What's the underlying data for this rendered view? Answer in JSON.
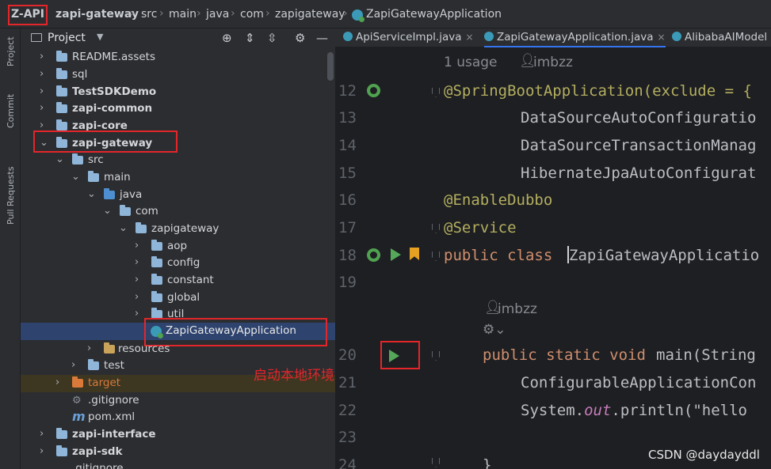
{
  "breadcrumb": {
    "app": "Z-API",
    "items": [
      "zapi-gateway",
      "src",
      "main",
      "java",
      "com",
      "zapigateway",
      "ZapiGatewayApplication"
    ]
  },
  "activity_bar": {
    "tabs": [
      "Project",
      "Commit",
      "Pull Requests"
    ]
  },
  "project_panel": {
    "title": "Project",
    "tree": [
      {
        "label": "README.assets"
      },
      {
        "label": "sql"
      },
      {
        "label": "TestSDKDemo"
      },
      {
        "label": "zapi-common"
      },
      {
        "label": "zapi-core"
      },
      {
        "label": "zapi-gateway"
      },
      {
        "label": "src"
      },
      {
        "label": "main"
      },
      {
        "label": "java"
      },
      {
        "label": "com"
      },
      {
        "label": "zapigateway"
      },
      {
        "label": "aop"
      },
      {
        "label": "config"
      },
      {
        "label": "constant"
      },
      {
        "label": "global"
      },
      {
        "label": "util"
      },
      {
        "label": "ZapiGatewayApplication"
      },
      {
        "label": "resources"
      },
      {
        "label": "test"
      },
      {
        "label": "target"
      },
      {
        "label": ".gitignore"
      },
      {
        "label": "pom.xml"
      },
      {
        "label": "zapi-interface"
      },
      {
        "label": "zapi-sdk"
      },
      {
        "label": ".gitignore"
      }
    ]
  },
  "editor": {
    "tabs": [
      "ApiServiceImpl.java",
      "ZapiGatewayApplication.java",
      "AlibabaAIModel"
    ],
    "usage_hint": "1 usage",
    "author": "imbzz",
    "author2": "imbzz",
    "line_numbers": [
      "12",
      "13",
      "14",
      "15",
      "16",
      "17",
      "18",
      "19",
      "20",
      "21",
      "22",
      "23",
      "24"
    ],
    "lines": {
      "l12": "@SpringBootApplication(exclude = {",
      "l13": "DataSourceAutoConfiguratio",
      "l14": "DataSourceTransactionManag",
      "l15": "HibernateJpaAutoConfigurat",
      "l16": "@EnableDubbo",
      "l17": "@Service",
      "l18_kw": "public class",
      "l18_rest": "ZapiGatewayApplicatio",
      "l20_kw": "public static void",
      "l20_rest": "main(String",
      "l21": "ConfigurableApplicationCon",
      "l22_a": "System.",
      "l22_b": "out",
      "l22_c": ".println(\"hello",
      "l24": "}"
    }
  },
  "annotation_text": "启动本地环境",
  "watermark": "CSDN @daydayddl",
  "colors": {
    "highlight_box": "#e3262a",
    "selection": "#2e436e",
    "folder": "#8fb5d9",
    "excluded_folder": "#d97a3a"
  }
}
